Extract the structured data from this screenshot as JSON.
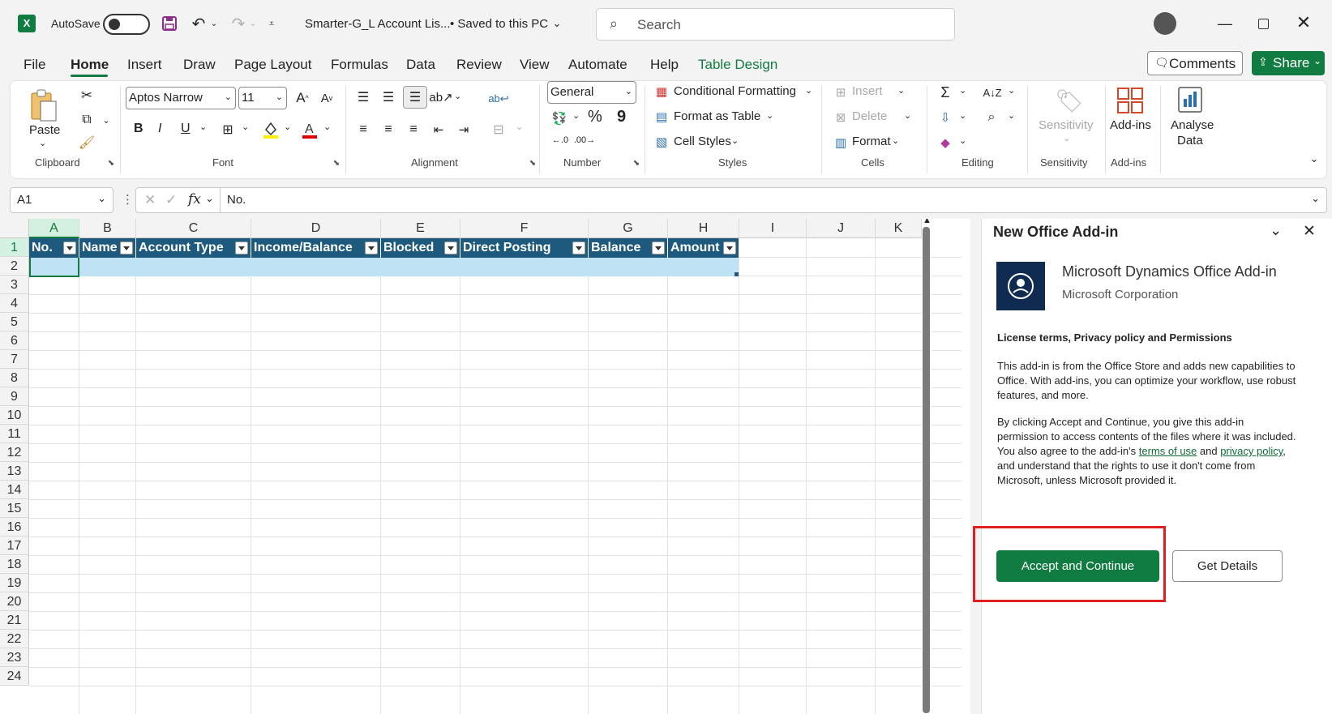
{
  "titlebar": {
    "autosave_label": "AutoSave",
    "file_title": "Smarter-G_L Account Lis...",
    "save_status": "• Saved to this PC",
    "search_placeholder": "Search"
  },
  "tabs": [
    "File",
    "Home",
    "Insert",
    "Draw",
    "Page Layout",
    "Formulas",
    "Data",
    "Review",
    "View",
    "Automate",
    "Help",
    "Table Design"
  ],
  "actions": {
    "comments": "Comments",
    "share": "Share"
  },
  "ribbon": {
    "clipboard": {
      "paste": "Paste",
      "label": "Clipboard"
    },
    "font": {
      "family": "Aptos Narrow",
      "size": "11",
      "label": "Font",
      "bold": "B",
      "italic": "I",
      "underline": "U"
    },
    "alignment": {
      "label": "Alignment"
    },
    "number": {
      "format": "General",
      "label": "Number",
      "percent": "%",
      "comma": "9"
    },
    "styles": {
      "conditional": "Conditional Formatting",
      "format_table": "Format as Table",
      "cell_styles": "Cell Styles",
      "label": "Styles"
    },
    "cells": {
      "insert": "Insert",
      "delete": "Delete",
      "format": "Format",
      "label": "Cells"
    },
    "editing": {
      "label": "Editing"
    },
    "sensitivity": {
      "button": "Sensitivity",
      "label": "Sensitivity"
    },
    "addins": {
      "button": "Add-ins",
      "label": "Add-ins"
    },
    "analyse": {
      "line1": "Analyse",
      "line2": "Data"
    }
  },
  "formula_bar": {
    "name_box": "A1",
    "fx": "fx",
    "content": "No."
  },
  "grid": {
    "columns": [
      "A",
      "B",
      "C",
      "D",
      "E",
      "F",
      "G",
      "H",
      "I",
      "J",
      "K"
    ],
    "rows": [
      "1",
      "2",
      "3",
      "4",
      "5",
      "6",
      "7",
      "8",
      "9",
      "10",
      "11",
      "12",
      "13",
      "14",
      "15",
      "16",
      "17",
      "18",
      "19",
      "20",
      "21",
      "22",
      "23",
      "24"
    ],
    "table_headers": [
      "No.",
      "Name",
      "Account Type",
      "Income/Balance",
      "Blocked",
      "Direct Posting",
      "Balance",
      "Amount"
    ]
  },
  "pane": {
    "title": "New Office Add-in",
    "addin_name": "Microsoft Dynamics Office Add-in",
    "publisher": "Microsoft Corporation",
    "section_title": "License terms, Privacy policy and Permissions",
    "para1": "This add-in is from the Office Store and adds new capabilities to Office. With add-ins, you can optimize your workflow, use robust features, and more.",
    "para2_a": "By clicking Accept and Continue, you give this add-in permission to access contents of the files where it was included. You also agree to the add-in's ",
    "terms_link": "terms of use",
    "para2_b": " and ",
    "privacy_link": "privacy policy",
    "para2_c": ", and understand that the rights to use it don't come from Microsoft, unless Microsoft provided it.",
    "accept": "Accept and Continue",
    "details": "Get Details"
  },
  "colors": {
    "excel_green": "#107c41",
    "table_header": "#1d5a7e",
    "selection": "#bfe3f5",
    "highlight_box": "#e02020"
  }
}
